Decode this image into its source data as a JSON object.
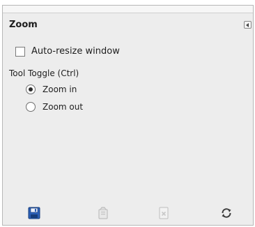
{
  "panel": {
    "title": "Zoom",
    "menu_icon": "tab-menu-icon"
  },
  "options": {
    "auto_resize": {
      "label": "Auto-resize window",
      "checked": false
    },
    "tool_toggle": {
      "label": "Tool Toggle  (Ctrl)",
      "choices": [
        {
          "label": "Zoom in",
          "selected": true
        },
        {
          "label": "Zoom out",
          "selected": false
        }
      ]
    }
  },
  "bottom_buttons": [
    {
      "icon": "save-icon",
      "enabled": true
    },
    {
      "icon": "restore-icon",
      "enabled": false
    },
    {
      "icon": "delete-icon",
      "enabled": false
    },
    {
      "icon": "reset-icon",
      "enabled": true
    }
  ],
  "colors": {
    "panel_bg": "#ededed",
    "save_blue": "#2b5fb6"
  }
}
